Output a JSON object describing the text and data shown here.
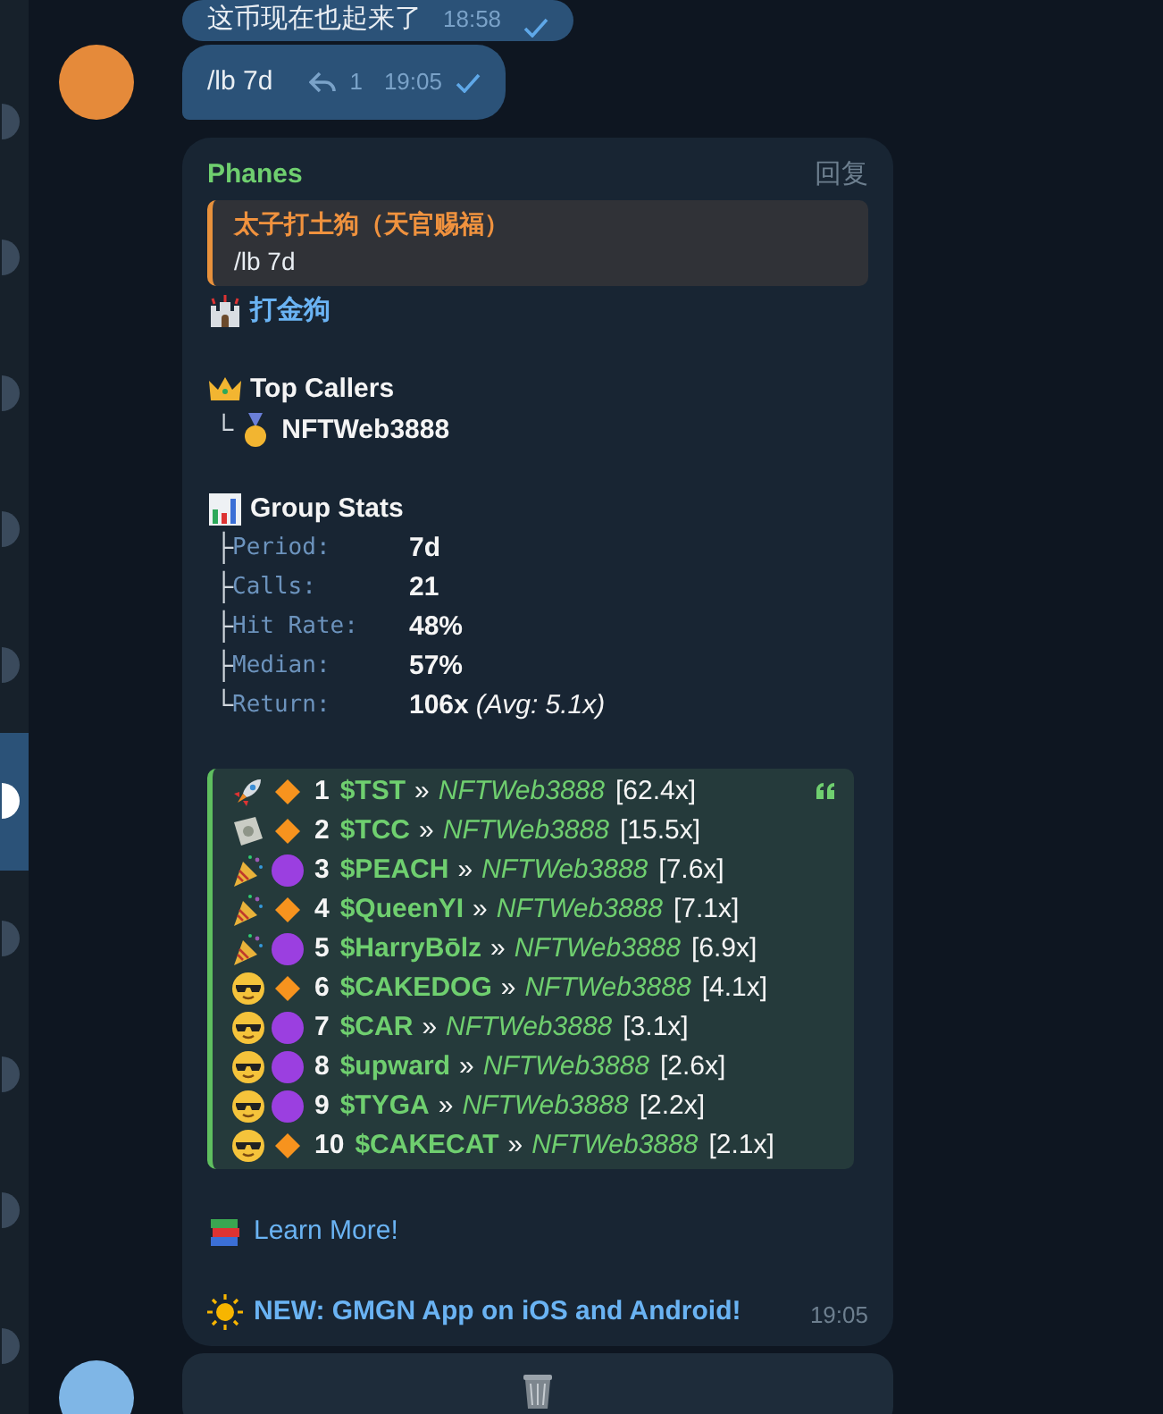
{
  "sidebar": {
    "items": [
      {
        "selected": false
      },
      {
        "selected": false
      },
      {
        "selected": false
      },
      {
        "selected": false
      },
      {
        "selected": false
      },
      {
        "selected": true
      },
      {
        "selected": false
      },
      {
        "selected": false
      },
      {
        "selected": false
      },
      {
        "selected": false
      }
    ]
  },
  "outgoing": [
    {
      "text": "这币现在也起来了",
      "time": "18:58",
      "read": true
    },
    {
      "text": "/lb 7d",
      "replies": "1",
      "time": "19:05",
      "read": true
    }
  ],
  "bot_message": {
    "sender": "Phanes",
    "reply_action": "回复",
    "quote": {
      "author": "太子打土狗（天官赐福）",
      "text": "/lb 7d"
    },
    "group_name": "打金狗",
    "top_callers": {
      "title": "Top Callers",
      "branch": "└",
      "caller": "NFTWeb3888"
    },
    "group_stats": {
      "title": "Group Stats",
      "rows": [
        {
          "branch": "├",
          "label": "Period:",
          "value": "7d"
        },
        {
          "branch": "├",
          "label": "Calls:",
          "value": "21"
        },
        {
          "branch": "├",
          "label": "Hit Rate:",
          "value": "48%"
        },
        {
          "branch": "├",
          "label": "Median:",
          "value": "57%"
        },
        {
          "branch": "└",
          "label": "Return:",
          "value": "106x",
          "note": "(Avg: 5.1x)"
        }
      ]
    },
    "leaderboard": [
      {
        "kind": "rocket",
        "diamond": true,
        "color": "#f7931e",
        "rank": "1",
        "token": "$TST",
        "separator": "»",
        "caller": "NFTWeb3888",
        "multiple": "[62.4x]"
      },
      {
        "kind": "money",
        "diamond": true,
        "color": "#f7931e",
        "rank": "2",
        "token": "$TCC",
        "separator": "»",
        "caller": "NFTWeb3888",
        "multiple": "[15.5x]"
      },
      {
        "kind": "party",
        "diamond": false,
        "color": "#9b3fe0",
        "rank": "3",
        "token": "$PEACH",
        "separator": "»",
        "caller": "NFTWeb3888",
        "multiple": "[7.6x]"
      },
      {
        "kind": "party",
        "diamond": true,
        "color": "#f7931e",
        "rank": "4",
        "token": "$QueenYI",
        "separator": "»",
        "caller": "NFTWeb3888",
        "multiple": "[7.1x]"
      },
      {
        "kind": "party",
        "diamond": false,
        "color": "#9b3fe0",
        "rank": "5",
        "token": "$HarryBōlz",
        "separator": "»",
        "caller": "NFTWeb3888",
        "multiple": "[6.9x]"
      },
      {
        "kind": "cool",
        "diamond": true,
        "color": "#f7931e",
        "rank": "6",
        "token": "$CAKEDOG",
        "separator": "»",
        "caller": "NFTWeb3888",
        "multiple": "[4.1x]"
      },
      {
        "kind": "cool",
        "diamond": false,
        "color": "#9b3fe0",
        "rank": "7",
        "token": "$CAR",
        "separator": "»",
        "caller": "NFTWeb3888",
        "multiple": "[3.1x]"
      },
      {
        "kind": "cool",
        "diamond": false,
        "color": "#9b3fe0",
        "rank": "8",
        "token": "$upward",
        "separator": "»",
        "caller": "NFTWeb3888",
        "multiple": "[2.6x]"
      },
      {
        "kind": "cool",
        "diamond": false,
        "color": "#9b3fe0",
        "rank": "9",
        "token": "$TYGA",
        "separator": "»",
        "caller": "NFTWeb3888",
        "multiple": "[2.2x]"
      },
      {
        "kind": "cool",
        "diamond": true,
        "color": "#f7931e",
        "rank": "10",
        "token": "$CAKECAT",
        "separator": "»",
        "caller": "NFTWeb3888",
        "multiple": "[2.1x]"
      }
    ],
    "learn_more": "Learn More!",
    "promo": "NEW: GMGN App on iOS and Android!",
    "time": "19:05"
  }
}
